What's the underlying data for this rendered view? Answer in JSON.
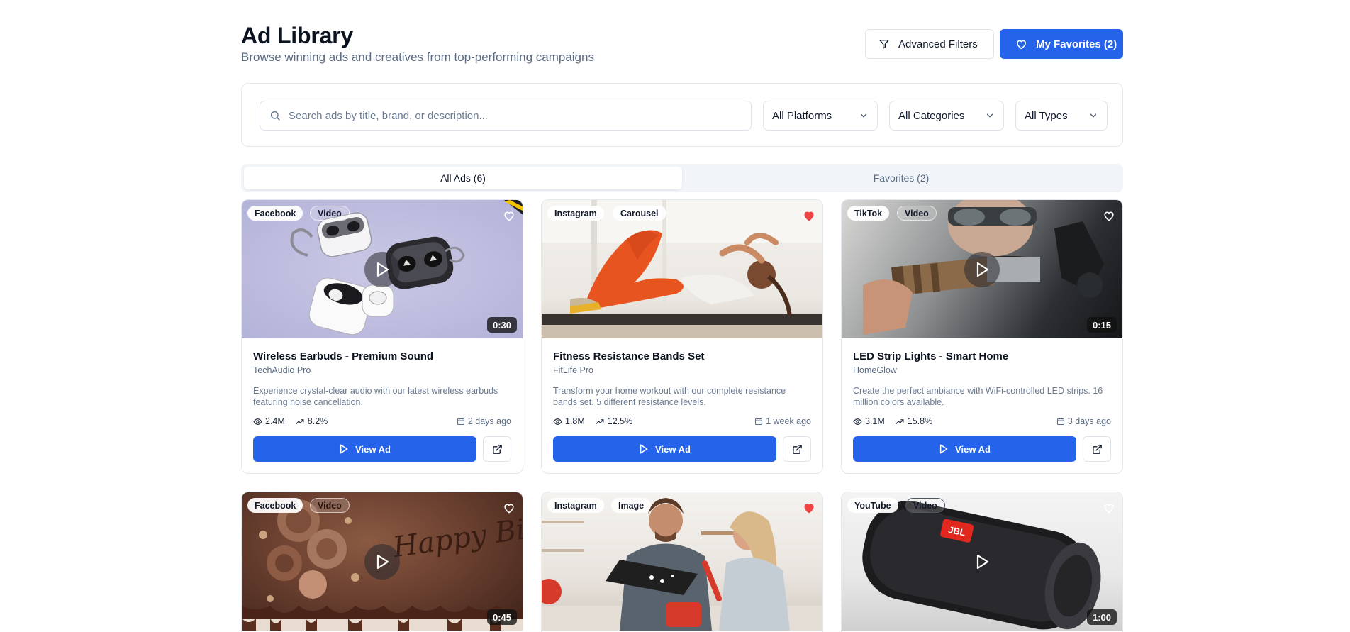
{
  "header": {
    "title": "Ad Library",
    "subtitle": "Browse winning ads and creatives from top-performing campaigns",
    "advanced_filters_label": "Advanced Filters",
    "my_favorites_label": "My Favorites (2)"
  },
  "filters": {
    "search_placeholder": "Search ads by title, brand, or description...",
    "platform_value": "All Platforms",
    "category_value": "All Categories",
    "type_value": "All Types"
  },
  "tabs": [
    {
      "label": "All Ads (6)",
      "active": true
    },
    {
      "label": "Favorites (2)",
      "active": false
    }
  ],
  "colors": {
    "accent": "#2563eb",
    "favorite_red": "#ef4444"
  },
  "view_ad_label": "View Ad",
  "ads": [
    {
      "platform": "Facebook",
      "type": "Video",
      "favorited": false,
      "duration": "0:30",
      "title": "Wireless Earbuds - Premium Sound",
      "brand": "TechAudio Pro",
      "description": "Experience crystal-clear audio with our latest wireless earbuds featuring noise cancellation.",
      "views": "2.4M",
      "ctr": "8.2%",
      "date": "2 days ago"
    },
    {
      "platform": "Instagram",
      "type": "Carousel",
      "favorited": true,
      "duration": "",
      "title": "Fitness Resistance Bands Set",
      "brand": "FitLife Pro",
      "description": "Transform your home workout with our complete resistance bands set. 5 different resistance levels.",
      "views": "1.8M",
      "ctr": "12.5%",
      "date": "1 week ago"
    },
    {
      "platform": "TikTok",
      "type": "Video",
      "favorited": false,
      "duration": "0:15",
      "title": "LED Strip Lights - Smart Home",
      "brand": "HomeGlow",
      "description": "Create the perfect ambiance with WiFi-controlled LED strips. 16 million colors available.",
      "views": "3.1M",
      "ctr": "15.8%",
      "date": "3 days ago"
    },
    {
      "platform": "Facebook",
      "type": "Video",
      "favorited": false,
      "duration": "0:45",
      "cake_text": "Happy Birthday"
    },
    {
      "platform": "Instagram",
      "type": "Image",
      "favorited": true,
      "duration": ""
    },
    {
      "platform": "YouTube",
      "type": "Video",
      "favorited": false,
      "duration": "1:00",
      "speaker_logo": "JBL"
    }
  ]
}
